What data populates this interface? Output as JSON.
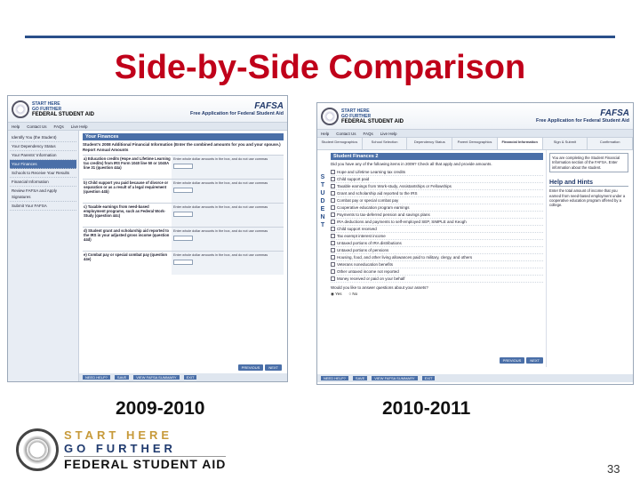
{
  "slide": {
    "title": "Side-by-Side Comparison",
    "page_number": "33",
    "brand": {
      "line1": "START HERE",
      "line2": "GO FURTHER",
      "line3": "FEDERAL STUDENT AID"
    }
  },
  "left": {
    "year": "2009-2010",
    "logo_text": [
      "START HERE",
      "GO FURTHER",
      "FEDERAL STUDENT AID"
    ],
    "fafsa_title": "FAFSA",
    "fafsa_subtitle": "Free Application for Federal Student Aid",
    "nav": [
      "Help",
      "Contact Us",
      "FAQs",
      "Live Help"
    ],
    "sidebar": [
      "Identify You (the Student)",
      "Your Dependency Status",
      "Your Parents' Information",
      "Your Finances",
      "Schools to Receive Your Results",
      "Financial Information",
      "Review FAFSA and Apply Signatures",
      "Submit Your FAFSA"
    ],
    "panel_title": "Your Finances",
    "intro": "Student's 2008 Additional Financial Information (Enter the combined amounts for you and your spouse.) Report Annual Amounts",
    "questions": [
      {
        "text": "a) Education credits (Hope and Lifetime Learning tax credits) from IRS Form 1040 line 50 or 1040A line 31 (question 44a)",
        "input_hint": "Enter whole dollar amounts in the box, and do not use commas"
      },
      {
        "text": "b) Child support you paid because of divorce or separation or as a result of a legal requirement (question 44b)",
        "input_hint": "Enter whole dollar amounts in the box, and do not use commas"
      },
      {
        "text": "c) Taxable earnings from need-based employment programs, such as Federal Work-Study (question 44c)",
        "input_hint": "Enter whole dollar amounts in the box, and do not use commas"
      },
      {
        "text": "d) Student grant and scholarship aid reported to the IRS in your adjusted gross income (question 44d)",
        "input_hint": "Enter whole dollar amounts in the box, and do not use commas"
      },
      {
        "text": "e) Combat pay or special combat pay (question 44e)",
        "input_hint": "Enter whole dollar amounts in the box, and do not use commas"
      }
    ],
    "buttons": {
      "previous": "PREVIOUS",
      "next": "NEXT"
    },
    "footer": {
      "help": "NEED HELP?",
      "save": "SAVE",
      "view": "VIEW FAFSA SUMMARY",
      "exit": "EXIT"
    }
  },
  "right": {
    "year": "2010-2011",
    "fafsa_title": "FAFSA",
    "fafsa_subtitle": "Free Application for Federal Student Aid",
    "nav": [
      "Help",
      "Contact Us",
      "FAQs",
      "Live Help"
    ],
    "tabs": [
      "Student Demographics",
      "School Selection",
      "Dependency Status",
      "Parent Demographics",
      "Financial Information",
      "Sign & Submit",
      "Confirmation"
    ],
    "vertical_label": [
      "S",
      "T",
      "U",
      "D",
      "E",
      "N",
      "T"
    ],
    "panel_title": "Student Finances 2",
    "intro": "Did you have any of the following items in 2009? Check all that apply and provide amounts.",
    "checklist": [
      "Hope and Lifetime Learning tax credits",
      "Child support paid",
      "Taxable earnings from Work-study, Assistantships or Fellowships",
      "Grant and scholarship aid reported to the IRS",
      "Combat pay or special combat pay",
      "Cooperative education program earnings",
      "Payments to tax-deferred pension and savings plans",
      "IRA deductions and payments to self-employed SEP, SIMPLE and Keogh",
      "Child support received",
      "Tax exempt interest income",
      "Untaxed portions of IRA distributions",
      "Untaxed portions of pensions",
      "Housing, food, and other living allowances paid to military, clergy, and others",
      "Veterans noneducation benefits",
      "Other untaxed income not reported",
      "Money received or paid on your behalf"
    ],
    "radio_question": "Would you like to answer questions about your assets?",
    "radios": [
      "Yes",
      "No"
    ],
    "info_box": "You are completing the Student Financial Information section of the FAFSA. Enter information about the student.",
    "help_title": "Help and Hints",
    "help_text": "Enter the total amount of income that you earned from need-based employment under a cooperative education program offered by a college.",
    "buttons": {
      "previous": "PREVIOUS",
      "next": "NEXT"
    },
    "footer": {
      "help": "NEED HELP?",
      "save": "SAVE",
      "view": "VIEW FAFSA SUMMARY",
      "exit": "EXIT"
    }
  }
}
